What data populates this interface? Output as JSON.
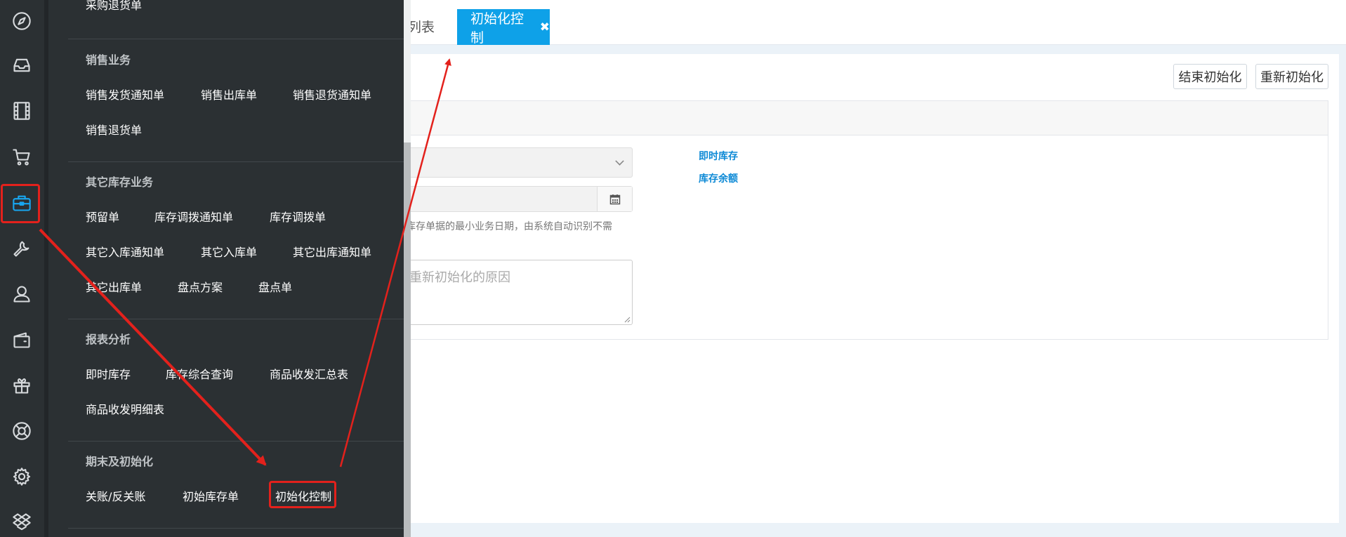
{
  "tabs": {
    "list_label": "-列表",
    "active_label": "初始化控制",
    "close_glyph": "✖"
  },
  "toolbar": {
    "end_label": "结束初始化",
    "reinit_label": "重新初始化"
  },
  "form": {
    "hint_text": "库存单据的最小业务日期，由系统自动识别不需",
    "reason_placeholder": "重新初始化的原因"
  },
  "links": {
    "instant_stock": "即时库存",
    "stock_balance": "库存余额"
  },
  "rail": {
    "icons": [
      "compass-icon",
      "inbox-icon",
      "film-icon",
      "cart-icon",
      "briefcase-icon",
      "wrench-icon",
      "user-icon",
      "wallet-icon",
      "gift-icon",
      "lifebuoy-icon",
      "gear-icon",
      "dropbox-icon"
    ],
    "active_icon": "briefcase-icon"
  },
  "menu": {
    "top_partial": "采购退货单",
    "sales": {
      "title": "销售业务",
      "items": [
        "销售发货通知单",
        "销售出库单",
        "销售退货通知单",
        "销售退货单"
      ]
    },
    "other_stock": {
      "title": "其它库存业务",
      "items": [
        "预留单",
        "库存调拨通知单",
        "库存调拨单",
        "其它入库通知单",
        "其它入库单",
        "其它出库通知单",
        "其它出库单",
        "盘点方案",
        "盘点单"
      ]
    },
    "reports": {
      "title": "报表分析",
      "items": [
        "即时库存",
        "库存综合查询",
        "商品收发汇总表",
        "商品收发明细表"
      ]
    },
    "period": {
      "title": "期末及初始化",
      "items": [
        "关账/反关账",
        "初始库存单",
        "初始化控制"
      ]
    }
  },
  "colors": {
    "accent": "#0ea1e8",
    "sidebar_bg": "#2b3033",
    "annotation_red": "#e3211c",
    "link_blue": "#0e8ad6"
  }
}
